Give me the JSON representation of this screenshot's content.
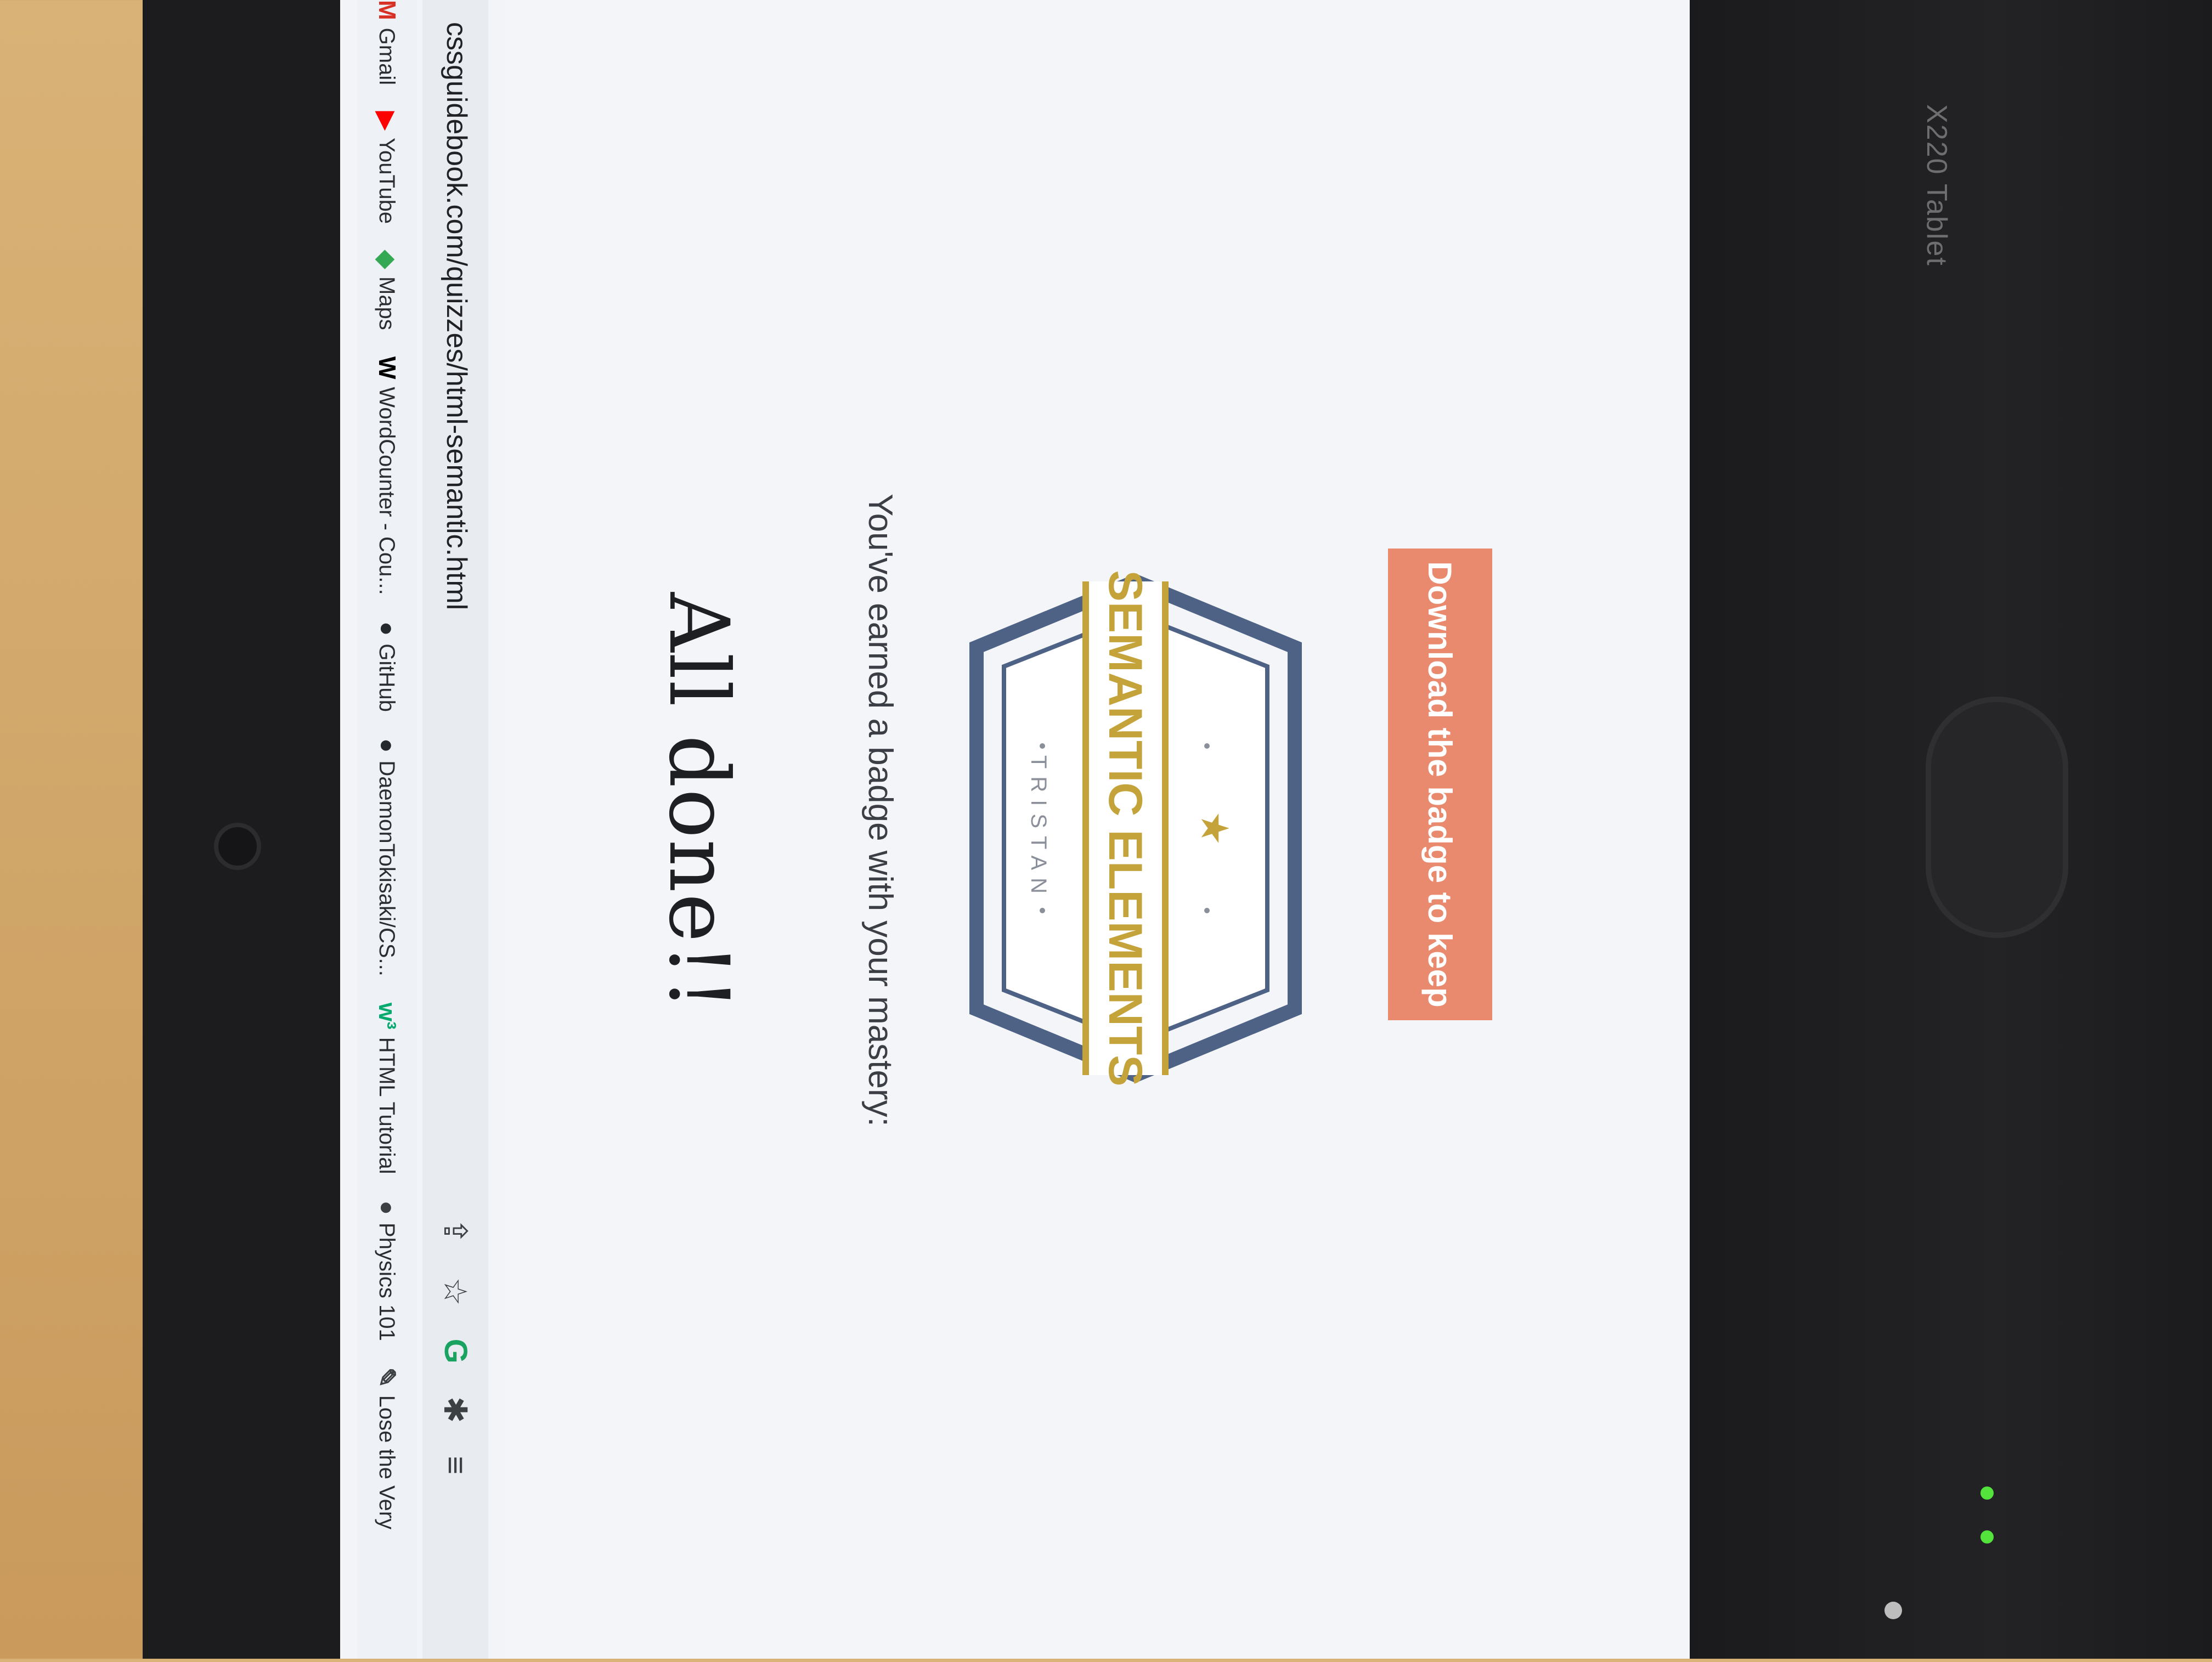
{
  "browser": {
    "tab_close": "×",
    "new_tab": "+",
    "url": "cssguidebook.com/quizzes/html-semantic.html",
    "bookmarks": [
      {
        "icon": "M",
        "label": "Gmail"
      },
      {
        "icon": "▶",
        "label": "YouTube"
      },
      {
        "icon": "◆",
        "label": "Maps"
      },
      {
        "icon": "W",
        "label": "WordCounter - Cou..."
      },
      {
        "icon": "●",
        "label": "GitHub"
      },
      {
        "icon": "●",
        "label": "DaemonTokisaki/CS..."
      },
      {
        "icon": "w³",
        "label": "HTML Tutorial"
      },
      {
        "icon": "●",
        "label": "Physics 101"
      },
      {
        "icon": "✎",
        "label": "Lose the Very"
      }
    ]
  },
  "page": {
    "title": "All done!!",
    "subtitle": "You've earned a badge with your mastery:",
    "badge": {
      "label": "SEMANTIC ELEMENTS",
      "name": "TRISTAN"
    },
    "download_label": "Download the badge to keep"
  },
  "device": {
    "model": "X220 Tablet"
  },
  "colors": {
    "badge_navy": "#4d6285",
    "badge_gold": "#c4a33a",
    "button": "#e98a6e"
  }
}
